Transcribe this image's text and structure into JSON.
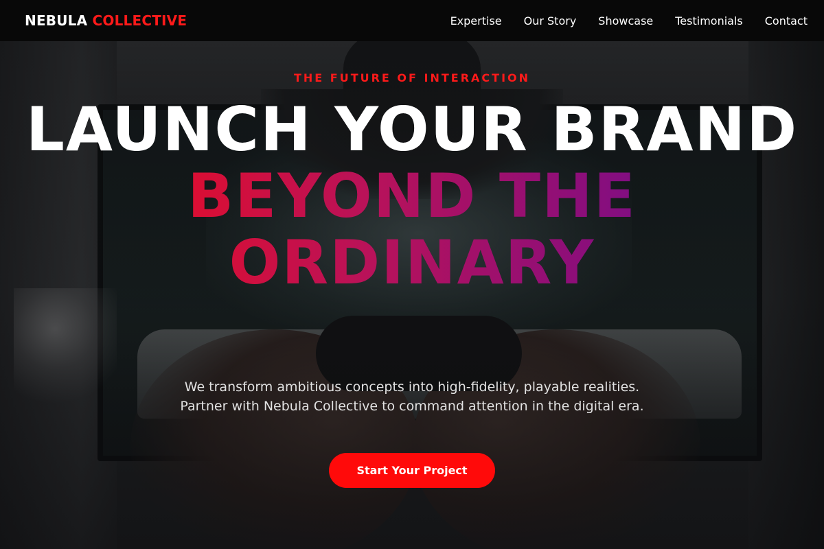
{
  "brand": {
    "name_part1": "NEBULA",
    "name_part2": "COLLECTIVE"
  },
  "nav": {
    "links": [
      {
        "label": "Expertise"
      },
      {
        "label": "Our Story"
      },
      {
        "label": "Showcase"
      },
      {
        "label": "Testimonials"
      },
      {
        "label": "Contact"
      }
    ]
  },
  "hero": {
    "eyebrow": "THE FUTURE OF INTERACTION",
    "headline_line1": "LAUNCH YOUR BRAND",
    "headline_line2": "BEYOND THE ORDINARY",
    "subtitle": "We transform ambitious concepts into high-fidelity, playable realities. Partner with Nebula Collective to command attention in the digital era.",
    "cta_label": "Start Your Project",
    "background_image": "person-holding-game-controller-in-front-of-tv"
  },
  "colors": {
    "accent": "#ff1a1a",
    "gradient_start": "#ff0a0a",
    "gradient_end": "#5a0a9e",
    "navbar_bg": "#080808"
  }
}
